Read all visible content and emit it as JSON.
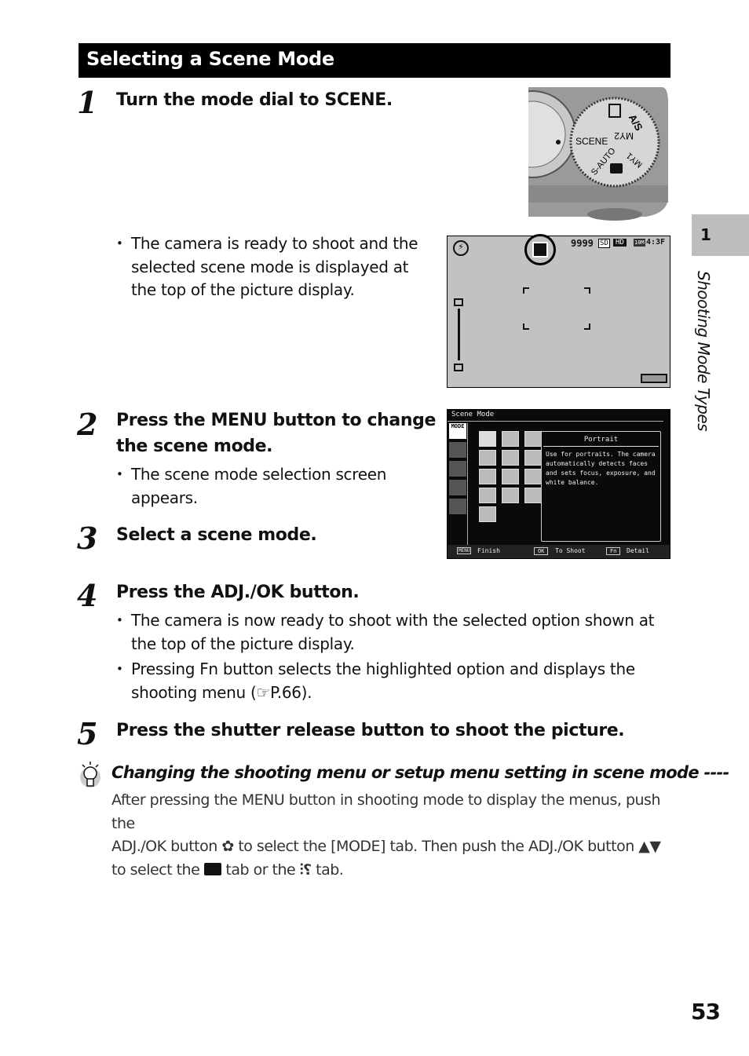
{
  "header": {
    "title": "Selecting a Scene Mode"
  },
  "steps": [
    {
      "number": "1",
      "title": "Turn the mode dial to SCENE.",
      "bullets": [
        "The camera is ready to shoot and the selected scene mode is displayed at the top of the picture display."
      ]
    },
    {
      "number": "2",
      "title": "Press the MENU button to change the scene mode.",
      "bullets": [
        "The scene mode selection screen appears."
      ]
    },
    {
      "number": "3",
      "title": "Select a scene mode.",
      "bullets": []
    },
    {
      "number": "4",
      "title": "Press the ADJ./OK button.",
      "bullets": [
        "The camera is now ready to shoot with the selected option shown at the top of the picture display.",
        "Pressing Fn button selects the highlighted option and displays the shooting menu (☞P.66)."
      ]
    },
    {
      "number": "5",
      "title": "Press the shutter release button to shoot the picture.",
      "bullets": []
    }
  ],
  "dial": {
    "labels": [
      "SCENE",
      "S-AUTO",
      "MY1",
      "MY2",
      "A/S"
    ]
  },
  "preview": {
    "shots": "9999",
    "media": "SD",
    "quality": "HD",
    "size": "10M",
    "aspect": "4:3F"
  },
  "menu_screen": {
    "title": "Scene Mode",
    "tab_label": "MODE",
    "option_title": "Portrait",
    "description": "Use for portraits. The camera automatically detects faces and sets focus, exposure, and white balance.",
    "footer": {
      "menu_key": "MENU",
      "menu_label": "Finish",
      "ok_key": "OK",
      "ok_label": "To Shoot",
      "fn_key": "Fn",
      "fn_label": "Detail"
    }
  },
  "tip": {
    "title": "Changing the shooting menu or setup menu setting in scene mode ----",
    "line1": "After pressing the MENU button in shooting mode to display the menus, push the",
    "line2a": "ADJ./OK button",
    "line2b": "to select the [MODE] tab. Then push the ADJ./OK button",
    "line2c": "▲▼",
    "line3a": "to select the",
    "line3b": "tab or the",
    "line3c": "tab."
  },
  "side_tab": {
    "chapter": "1",
    "title": "Shooting Mode Types"
  },
  "page_number": "53"
}
